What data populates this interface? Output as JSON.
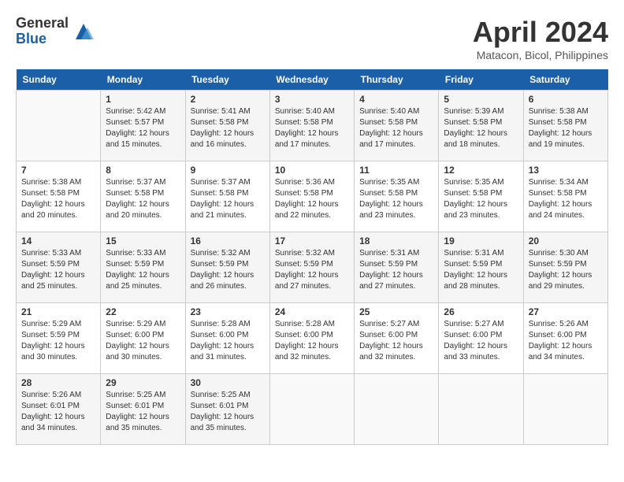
{
  "header": {
    "logo_general": "General",
    "logo_blue": "Blue",
    "month_title": "April 2024",
    "subtitle": "Matacon, Bicol, Philippines"
  },
  "days_of_week": [
    "Sunday",
    "Monday",
    "Tuesday",
    "Wednesday",
    "Thursday",
    "Friday",
    "Saturday"
  ],
  "weeks": [
    [
      {
        "day": "",
        "sunrise": "",
        "sunset": "",
        "daylight": ""
      },
      {
        "day": "1",
        "sunrise": "Sunrise: 5:42 AM",
        "sunset": "Sunset: 5:57 PM",
        "daylight": "Daylight: 12 hours and 15 minutes."
      },
      {
        "day": "2",
        "sunrise": "Sunrise: 5:41 AM",
        "sunset": "Sunset: 5:58 PM",
        "daylight": "Daylight: 12 hours and 16 minutes."
      },
      {
        "day": "3",
        "sunrise": "Sunrise: 5:40 AM",
        "sunset": "Sunset: 5:58 PM",
        "daylight": "Daylight: 12 hours and 17 minutes."
      },
      {
        "day": "4",
        "sunrise": "Sunrise: 5:40 AM",
        "sunset": "Sunset: 5:58 PM",
        "daylight": "Daylight: 12 hours and 17 minutes."
      },
      {
        "day": "5",
        "sunrise": "Sunrise: 5:39 AM",
        "sunset": "Sunset: 5:58 PM",
        "daylight": "Daylight: 12 hours and 18 minutes."
      },
      {
        "day": "6",
        "sunrise": "Sunrise: 5:38 AM",
        "sunset": "Sunset: 5:58 PM",
        "daylight": "Daylight: 12 hours and 19 minutes."
      }
    ],
    [
      {
        "day": "7",
        "sunrise": "Sunrise: 5:38 AM",
        "sunset": "Sunset: 5:58 PM",
        "daylight": "Daylight: 12 hours and 20 minutes."
      },
      {
        "day": "8",
        "sunrise": "Sunrise: 5:37 AM",
        "sunset": "Sunset: 5:58 PM",
        "daylight": "Daylight: 12 hours and 20 minutes."
      },
      {
        "day": "9",
        "sunrise": "Sunrise: 5:37 AM",
        "sunset": "Sunset: 5:58 PM",
        "daylight": "Daylight: 12 hours and 21 minutes."
      },
      {
        "day": "10",
        "sunrise": "Sunrise: 5:36 AM",
        "sunset": "Sunset: 5:58 PM",
        "daylight": "Daylight: 12 hours and 22 minutes."
      },
      {
        "day": "11",
        "sunrise": "Sunrise: 5:35 AM",
        "sunset": "Sunset: 5:58 PM",
        "daylight": "Daylight: 12 hours and 23 minutes."
      },
      {
        "day": "12",
        "sunrise": "Sunrise: 5:35 AM",
        "sunset": "Sunset: 5:58 PM",
        "daylight": "Daylight: 12 hours and 23 minutes."
      },
      {
        "day": "13",
        "sunrise": "Sunrise: 5:34 AM",
        "sunset": "Sunset: 5:58 PM",
        "daylight": "Daylight: 12 hours and 24 minutes."
      }
    ],
    [
      {
        "day": "14",
        "sunrise": "Sunrise: 5:33 AM",
        "sunset": "Sunset: 5:59 PM",
        "daylight": "Daylight: 12 hours and 25 minutes."
      },
      {
        "day": "15",
        "sunrise": "Sunrise: 5:33 AM",
        "sunset": "Sunset: 5:59 PM",
        "daylight": "Daylight: 12 hours and 25 minutes."
      },
      {
        "day": "16",
        "sunrise": "Sunrise: 5:32 AM",
        "sunset": "Sunset: 5:59 PM",
        "daylight": "Daylight: 12 hours and 26 minutes."
      },
      {
        "day": "17",
        "sunrise": "Sunrise: 5:32 AM",
        "sunset": "Sunset: 5:59 PM",
        "daylight": "Daylight: 12 hours and 27 minutes."
      },
      {
        "day": "18",
        "sunrise": "Sunrise: 5:31 AM",
        "sunset": "Sunset: 5:59 PM",
        "daylight": "Daylight: 12 hours and 27 minutes."
      },
      {
        "day": "19",
        "sunrise": "Sunrise: 5:31 AM",
        "sunset": "Sunset: 5:59 PM",
        "daylight": "Daylight: 12 hours and 28 minutes."
      },
      {
        "day": "20",
        "sunrise": "Sunrise: 5:30 AM",
        "sunset": "Sunset: 5:59 PM",
        "daylight": "Daylight: 12 hours and 29 minutes."
      }
    ],
    [
      {
        "day": "21",
        "sunrise": "Sunrise: 5:29 AM",
        "sunset": "Sunset: 5:59 PM",
        "daylight": "Daylight: 12 hours and 30 minutes."
      },
      {
        "day": "22",
        "sunrise": "Sunrise: 5:29 AM",
        "sunset": "Sunset: 6:00 PM",
        "daylight": "Daylight: 12 hours and 30 minutes."
      },
      {
        "day": "23",
        "sunrise": "Sunrise: 5:28 AM",
        "sunset": "Sunset: 6:00 PM",
        "daylight": "Daylight: 12 hours and 31 minutes."
      },
      {
        "day": "24",
        "sunrise": "Sunrise: 5:28 AM",
        "sunset": "Sunset: 6:00 PM",
        "daylight": "Daylight: 12 hours and 32 minutes."
      },
      {
        "day": "25",
        "sunrise": "Sunrise: 5:27 AM",
        "sunset": "Sunset: 6:00 PM",
        "daylight": "Daylight: 12 hours and 32 minutes."
      },
      {
        "day": "26",
        "sunrise": "Sunrise: 5:27 AM",
        "sunset": "Sunset: 6:00 PM",
        "daylight": "Daylight: 12 hours and 33 minutes."
      },
      {
        "day": "27",
        "sunrise": "Sunrise: 5:26 AM",
        "sunset": "Sunset: 6:00 PM",
        "daylight": "Daylight: 12 hours and 34 minutes."
      }
    ],
    [
      {
        "day": "28",
        "sunrise": "Sunrise: 5:26 AM",
        "sunset": "Sunset: 6:01 PM",
        "daylight": "Daylight: 12 hours and 34 minutes."
      },
      {
        "day": "29",
        "sunrise": "Sunrise: 5:25 AM",
        "sunset": "Sunset: 6:01 PM",
        "daylight": "Daylight: 12 hours and 35 minutes."
      },
      {
        "day": "30",
        "sunrise": "Sunrise: 5:25 AM",
        "sunset": "Sunset: 6:01 PM",
        "daylight": "Daylight: 12 hours and 35 minutes."
      },
      {
        "day": "",
        "sunrise": "",
        "sunset": "",
        "daylight": ""
      },
      {
        "day": "",
        "sunrise": "",
        "sunset": "",
        "daylight": ""
      },
      {
        "day": "",
        "sunrise": "",
        "sunset": "",
        "daylight": ""
      },
      {
        "day": "",
        "sunrise": "",
        "sunset": "",
        "daylight": ""
      }
    ]
  ]
}
